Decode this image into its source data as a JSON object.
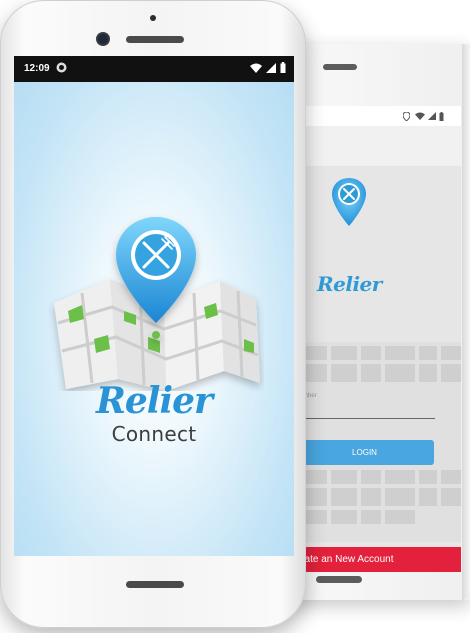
{
  "front_phone": {
    "status_bar": {
      "time": "12:09",
      "icons": [
        "app-notification-icon",
        "wifi-icon",
        "signal-icon",
        "battery-icon"
      ]
    },
    "splash": {
      "brand_name": "Relier",
      "brand_sub": "Connect",
      "logo_icon": "map-pin-fork-knife-icon"
    }
  },
  "back_phone": {
    "status_bar": {
      "icons": [
        "location-icon",
        "wifi-icon",
        "battery-icon"
      ]
    },
    "login": {
      "brand_name": "Relier",
      "field_label": "mber",
      "login_button": "LOGIN",
      "create_account_button": "eate an New Account"
    }
  },
  "colors": {
    "brand_blue": "#2a93d5",
    "login_blue": "#4aa6e0",
    "create_red": "#e3213c",
    "map_green": "#6cc04a"
  }
}
